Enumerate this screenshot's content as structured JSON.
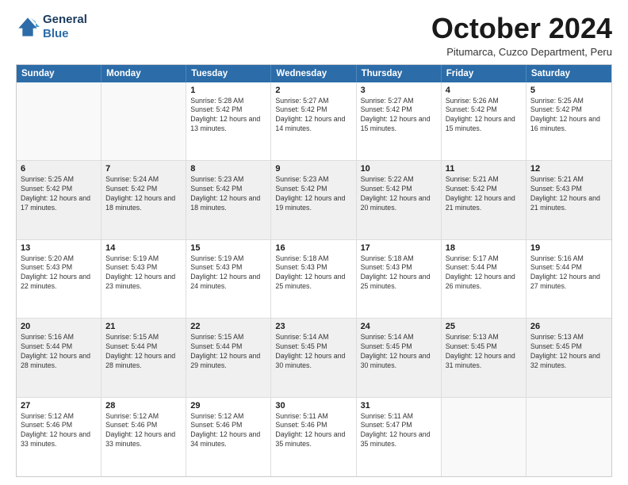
{
  "logo": {
    "line1": "General",
    "line2": "Blue"
  },
  "title": "October 2024",
  "subtitle": "Pitumarca, Cuzco Department, Peru",
  "days_of_week": [
    "Sunday",
    "Monday",
    "Tuesday",
    "Wednesday",
    "Thursday",
    "Friday",
    "Saturday"
  ],
  "weeks": [
    [
      {
        "day": "",
        "info": "",
        "empty": true
      },
      {
        "day": "",
        "info": "",
        "empty": true
      },
      {
        "day": "1",
        "info": "Sunrise: 5:28 AM\nSunset: 5:42 PM\nDaylight: 12 hours and 13 minutes."
      },
      {
        "day": "2",
        "info": "Sunrise: 5:27 AM\nSunset: 5:42 PM\nDaylight: 12 hours and 14 minutes."
      },
      {
        "day": "3",
        "info": "Sunrise: 5:27 AM\nSunset: 5:42 PM\nDaylight: 12 hours and 15 minutes."
      },
      {
        "day": "4",
        "info": "Sunrise: 5:26 AM\nSunset: 5:42 PM\nDaylight: 12 hours and 15 minutes."
      },
      {
        "day": "5",
        "info": "Sunrise: 5:25 AM\nSunset: 5:42 PM\nDaylight: 12 hours and 16 minutes."
      }
    ],
    [
      {
        "day": "6",
        "info": "Sunrise: 5:25 AM\nSunset: 5:42 PM\nDaylight: 12 hours and 17 minutes."
      },
      {
        "day": "7",
        "info": "Sunrise: 5:24 AM\nSunset: 5:42 PM\nDaylight: 12 hours and 18 minutes."
      },
      {
        "day": "8",
        "info": "Sunrise: 5:23 AM\nSunset: 5:42 PM\nDaylight: 12 hours and 18 minutes."
      },
      {
        "day": "9",
        "info": "Sunrise: 5:23 AM\nSunset: 5:42 PM\nDaylight: 12 hours and 19 minutes."
      },
      {
        "day": "10",
        "info": "Sunrise: 5:22 AM\nSunset: 5:42 PM\nDaylight: 12 hours and 20 minutes."
      },
      {
        "day": "11",
        "info": "Sunrise: 5:21 AM\nSunset: 5:42 PM\nDaylight: 12 hours and 21 minutes."
      },
      {
        "day": "12",
        "info": "Sunrise: 5:21 AM\nSunset: 5:43 PM\nDaylight: 12 hours and 21 minutes."
      }
    ],
    [
      {
        "day": "13",
        "info": "Sunrise: 5:20 AM\nSunset: 5:43 PM\nDaylight: 12 hours and 22 minutes."
      },
      {
        "day": "14",
        "info": "Sunrise: 5:19 AM\nSunset: 5:43 PM\nDaylight: 12 hours and 23 minutes."
      },
      {
        "day": "15",
        "info": "Sunrise: 5:19 AM\nSunset: 5:43 PM\nDaylight: 12 hours and 24 minutes."
      },
      {
        "day": "16",
        "info": "Sunrise: 5:18 AM\nSunset: 5:43 PM\nDaylight: 12 hours and 25 minutes."
      },
      {
        "day": "17",
        "info": "Sunrise: 5:18 AM\nSunset: 5:43 PM\nDaylight: 12 hours and 25 minutes."
      },
      {
        "day": "18",
        "info": "Sunrise: 5:17 AM\nSunset: 5:44 PM\nDaylight: 12 hours and 26 minutes."
      },
      {
        "day": "19",
        "info": "Sunrise: 5:16 AM\nSunset: 5:44 PM\nDaylight: 12 hours and 27 minutes."
      }
    ],
    [
      {
        "day": "20",
        "info": "Sunrise: 5:16 AM\nSunset: 5:44 PM\nDaylight: 12 hours and 28 minutes."
      },
      {
        "day": "21",
        "info": "Sunrise: 5:15 AM\nSunset: 5:44 PM\nDaylight: 12 hours and 28 minutes."
      },
      {
        "day": "22",
        "info": "Sunrise: 5:15 AM\nSunset: 5:44 PM\nDaylight: 12 hours and 29 minutes."
      },
      {
        "day": "23",
        "info": "Sunrise: 5:14 AM\nSunset: 5:45 PM\nDaylight: 12 hours and 30 minutes."
      },
      {
        "day": "24",
        "info": "Sunrise: 5:14 AM\nSunset: 5:45 PM\nDaylight: 12 hours and 30 minutes."
      },
      {
        "day": "25",
        "info": "Sunrise: 5:13 AM\nSunset: 5:45 PM\nDaylight: 12 hours and 31 minutes."
      },
      {
        "day": "26",
        "info": "Sunrise: 5:13 AM\nSunset: 5:45 PM\nDaylight: 12 hours and 32 minutes."
      }
    ],
    [
      {
        "day": "27",
        "info": "Sunrise: 5:12 AM\nSunset: 5:46 PM\nDaylight: 12 hours and 33 minutes."
      },
      {
        "day": "28",
        "info": "Sunrise: 5:12 AM\nSunset: 5:46 PM\nDaylight: 12 hours and 33 minutes."
      },
      {
        "day": "29",
        "info": "Sunrise: 5:12 AM\nSunset: 5:46 PM\nDaylight: 12 hours and 34 minutes."
      },
      {
        "day": "30",
        "info": "Sunrise: 5:11 AM\nSunset: 5:46 PM\nDaylight: 12 hours and 35 minutes."
      },
      {
        "day": "31",
        "info": "Sunrise: 5:11 AM\nSunset: 5:47 PM\nDaylight: 12 hours and 35 minutes."
      },
      {
        "day": "",
        "info": "",
        "empty": true
      },
      {
        "day": "",
        "info": "",
        "empty": true
      }
    ]
  ]
}
